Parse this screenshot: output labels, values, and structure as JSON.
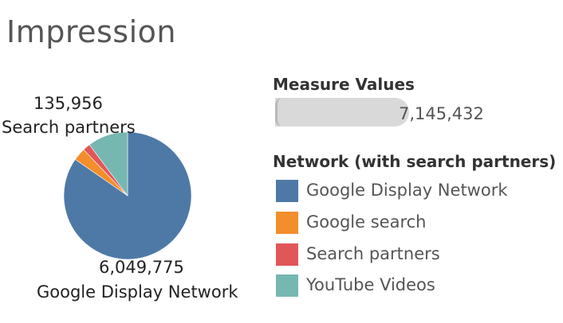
{
  "title": "Impression",
  "labels": {
    "small_value": "135,956",
    "small_name": "Search partners",
    "large_value": "6,049,775",
    "large_name": "Google Display Network"
  },
  "measure": {
    "title": "Measure Values",
    "value_text": "7,145,432"
  },
  "legend": {
    "title": "Network (with search partners)",
    "items": [
      {
        "label": "Google Display Network",
        "color": "#4e79a7"
      },
      {
        "label": "Google search",
        "color": "#f28e2b"
      },
      {
        "label": "Search partners",
        "color": "#e15759"
      },
      {
        "label": "YouTube Videos",
        "color": "#76b7b2"
      }
    ]
  },
  "chart_data": {
    "type": "pie",
    "title": "Impression",
    "total": 7145432,
    "slices": [
      {
        "name": "Google Display Network",
        "value": 6049775,
        "color": "#4e79a7"
      },
      {
        "name": "Google search",
        "value": 230000,
        "color": "#f28e2b"
      },
      {
        "name": "Search partners",
        "value": 135956,
        "color": "#e15759"
      },
      {
        "name": "YouTube Videos",
        "value": 729701,
        "color": "#76b7b2"
      }
    ]
  }
}
